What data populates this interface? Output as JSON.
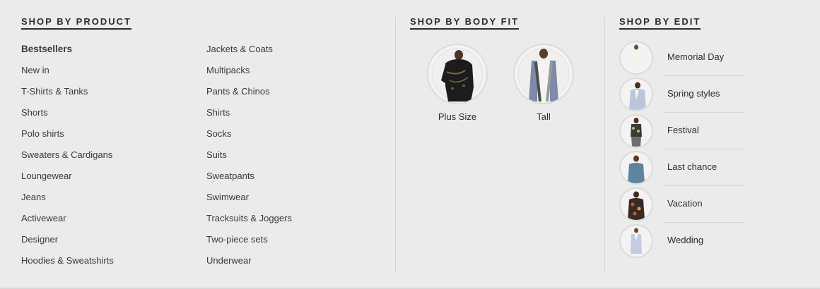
{
  "product": {
    "heading": "SHOP BY PRODUCT",
    "col1": [
      "Bestsellers",
      "New in",
      "T-Shirts & Tanks",
      "Shorts",
      "Polo shirts",
      "Sweaters & Cardigans",
      "Loungewear",
      "Jeans",
      "Activewear",
      "Designer",
      "Hoodies & Sweatshirts"
    ],
    "col2": [
      "Jackets & Coats",
      "Multipacks",
      "Pants & Chinos",
      "Shirts",
      "Socks",
      "Suits",
      "Sweatpants",
      "Swimwear",
      "Tracksuits & Joggers",
      "Two-piece sets",
      "Underwear"
    ]
  },
  "body_fit": {
    "heading": "SHOP BY BODY FIT",
    "items": [
      {
        "label": "Plus Size",
        "icon": "plus-size-model-image"
      },
      {
        "label": "Tall",
        "icon": "tall-model-image"
      }
    ]
  },
  "edit": {
    "heading": "SHOP BY EDIT",
    "items": [
      {
        "label": "Memorial Day",
        "icon": "memorial-day-image"
      },
      {
        "label": "Spring styles",
        "icon": "spring-styles-image"
      },
      {
        "label": "Festival",
        "icon": "festival-image"
      },
      {
        "label": "Last chance",
        "icon": "last-chance-image"
      },
      {
        "label": "Vacation",
        "icon": "vacation-image"
      },
      {
        "label": "Wedding",
        "icon": "wedding-image"
      }
    ]
  },
  "colors": {
    "background": "#ebebeb",
    "text": "#2d2d2d",
    "divider": "#d4d4d4"
  }
}
